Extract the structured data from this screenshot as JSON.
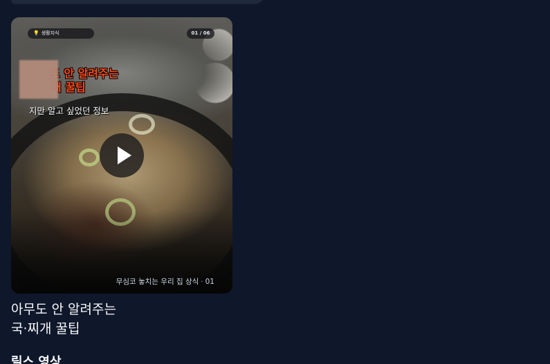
{
  "video_card": {
    "category_chip": {
      "icon": "lightbulb-icon",
      "label": "생활지식"
    },
    "page_counter": "01 / 06",
    "headline": {
      "line1": "도 안 알려주는",
      "line2": "개 꿀팁"
    },
    "subline": "지만 알고 싶었던 정보",
    "footer_caption": {
      "text": "무심코 놓치는 우리 집 상식",
      "separator": "·",
      "number": "01"
    },
    "play_icon": "play-icon"
  },
  "video_title": {
    "line1": "아무도 안 알려주는",
    "line2": "국·찌개 꿀팁"
  },
  "section": {
    "heading": "릴스 영상"
  },
  "colors": {
    "background": "#0f172a",
    "headline": "#ff4a1c",
    "text": "#f8fafc"
  }
}
